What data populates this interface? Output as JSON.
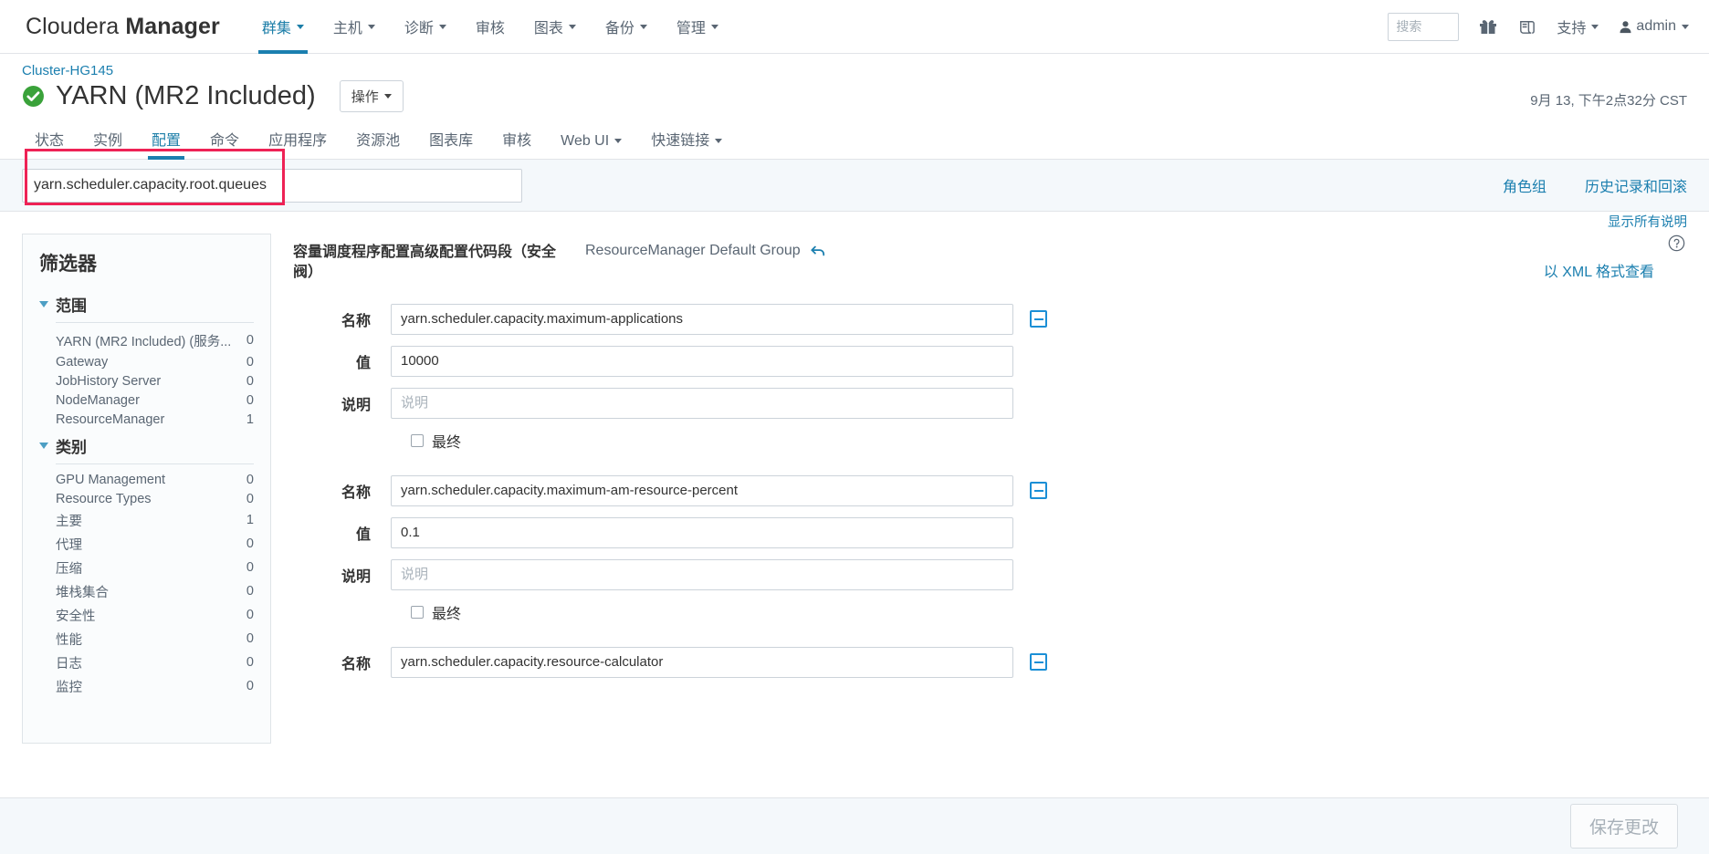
{
  "topbar": {
    "brand_light": "Cloudera ",
    "brand_bold": "Manager",
    "nav": [
      {
        "label": "群集",
        "caret": true,
        "active": true
      },
      {
        "label": "主机",
        "caret": true,
        "active": false
      },
      {
        "label": "诊断",
        "caret": true,
        "active": false
      },
      {
        "label": "审核",
        "caret": false,
        "active": false
      },
      {
        "label": "图表",
        "caret": true,
        "active": false
      },
      {
        "label": "备份",
        "caret": true,
        "active": false
      },
      {
        "label": "管理",
        "caret": true,
        "active": false
      }
    ],
    "search_placeholder": "搜索",
    "search_value": "",
    "gift_icon": "gift-icon",
    "parcel_icon": "parcel-icon",
    "support_label": "支持",
    "user_label": "admin"
  },
  "page": {
    "breadcrumb": "Cluster-HG145",
    "title": "YARN (MR2 Included)",
    "status_icon": "health-good-icon",
    "actions_label": "操作",
    "timestamp": "9月 13, 下午2点32分 CST"
  },
  "tabs": [
    {
      "label": "状态",
      "caret": false,
      "active": false
    },
    {
      "label": "实例",
      "caret": false,
      "active": false
    },
    {
      "label": "配置",
      "caret": false,
      "active": true
    },
    {
      "label": "命令",
      "caret": false,
      "active": false
    },
    {
      "label": "应用程序",
      "caret": false,
      "active": false
    },
    {
      "label": "资源池",
      "caret": false,
      "active": false
    },
    {
      "label": "图表库",
      "caret": false,
      "active": false
    },
    {
      "label": "审核",
      "caret": false,
      "active": false
    },
    {
      "label": "Web UI",
      "caret": true,
      "active": false
    },
    {
      "label": "快速链接",
      "caret": true,
      "active": false
    }
  ],
  "filterbar": {
    "search_value": "yarn.scheduler.capacity.root.queues",
    "search_placeholder": "",
    "role_groups_label": "角色组",
    "history_label": "历史记录和回滚",
    "highlight_color": "#ee2255"
  },
  "sidebar": {
    "title": "筛选器",
    "groups": [
      {
        "label": "范围",
        "items": [
          {
            "label": "YARN (MR2 Included) (服务...",
            "count": "0"
          },
          {
            "label": "Gateway",
            "count": "0"
          },
          {
            "label": "JobHistory Server",
            "count": "0"
          },
          {
            "label": "NodeManager",
            "count": "0"
          },
          {
            "label": "ResourceManager",
            "count": "1"
          }
        ]
      },
      {
        "label": "类别",
        "items": [
          {
            "label": "GPU Management",
            "count": "0"
          },
          {
            "label": "Resource Types",
            "count": "0"
          },
          {
            "label": "主要",
            "count": "1"
          },
          {
            "label": "代理",
            "count": "0"
          },
          {
            "label": "压缩",
            "count": "0"
          },
          {
            "label": "堆栈集合",
            "count": "0"
          },
          {
            "label": "安全性",
            "count": "0"
          },
          {
            "label": "性能",
            "count": "0"
          },
          {
            "label": "日志",
            "count": "0"
          },
          {
            "label": "监控",
            "count": "0"
          }
        ]
      }
    ]
  },
  "config": {
    "show_all_label": "显示所有说明",
    "help_icon": "help-circle-icon",
    "xml_link_label": "以 XML 格式查看",
    "property_title": "容量调度程序配置高级配置代码段（安全阀）",
    "role_group": "ResourceManager Default Group",
    "undo_icon": "undo-arrow-icon",
    "labels": {
      "name": "名称",
      "value": "值",
      "description": "说明",
      "final": "最终"
    },
    "description_placeholder": "说明",
    "remove_icon": "minus-square-icon",
    "entries": [
      {
        "name": "yarn.scheduler.capacity.maximum-applications",
        "value": "10000",
        "description": "",
        "final": false,
        "partial": false
      },
      {
        "name": "yarn.scheduler.capacity.maximum-am-resource-percent",
        "value": "0.1",
        "description": "",
        "final": false,
        "partial": false
      },
      {
        "name": "yarn.scheduler.capacity.resource-calculator",
        "value": "",
        "description": "",
        "final": false,
        "partial": true
      }
    ]
  },
  "footer": {
    "save_label": "保存更改"
  }
}
